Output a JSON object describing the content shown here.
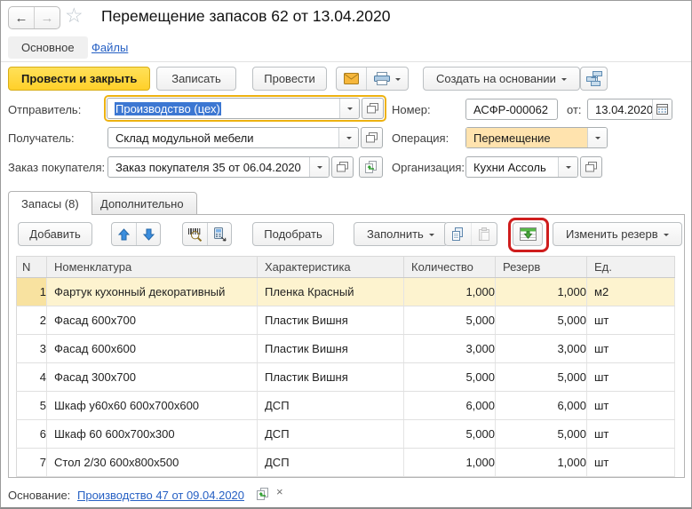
{
  "window": {
    "title": "Перемещение запасов 62 от 13.04.2020"
  },
  "nav": {
    "main_tab": "Основное",
    "files_link": "Файлы"
  },
  "toolbar": {
    "post_and_close": "Провести и закрыть",
    "write": "Записать",
    "post": "Провести",
    "create_based_on": "Создать на основании"
  },
  "form": {
    "sender": {
      "label": "Отправитель:",
      "value": "Производство (цех)"
    },
    "receiver": {
      "label": "Получатель:",
      "value": "Склад модульной мебели"
    },
    "customer_order": {
      "label": "Заказ покупателя:",
      "value": "Заказ покупателя 35 от 06.04.2020"
    },
    "number": {
      "label": "Номер:",
      "value": "АСФР-000062"
    },
    "date": {
      "label": "от:",
      "value": "13.04.2020"
    },
    "operation": {
      "label": "Операция:",
      "value": "Перемещение"
    },
    "organization": {
      "label": "Организация:",
      "value": "Кухни Ассоль"
    }
  },
  "tabs": {
    "inventory": "Запасы (8)",
    "additional": "Дополнительно"
  },
  "table_toolbar": {
    "add": "Добавить",
    "pick": "Подобрать",
    "fill": "Заполнить",
    "change_reserve": "Изменить резерв"
  },
  "table": {
    "columns": [
      "N",
      "Номенклатура",
      "Характеристика",
      "Количество",
      "Резерв",
      "Ед."
    ],
    "rows": [
      {
        "n": "1",
        "name": "Фартук кухонный декоративный",
        "characteristic": "Пленка Красный",
        "quantity": "1,000",
        "reserve": "1,000",
        "unit": "м2",
        "selected": true
      },
      {
        "n": "2",
        "name": "Фасад 600х700",
        "characteristic": "Пластик Вишня",
        "quantity": "5,000",
        "reserve": "5,000",
        "unit": "шт",
        "selected": false
      },
      {
        "n": "3",
        "name": "Фасад 600х600",
        "characteristic": "Пластик Вишня",
        "quantity": "3,000",
        "reserve": "3,000",
        "unit": "шт",
        "selected": false
      },
      {
        "n": "4",
        "name": "Фасад 300х700",
        "characteristic": "Пластик Вишня",
        "quantity": "5,000",
        "reserve": "5,000",
        "unit": "шт",
        "selected": false
      },
      {
        "n": "5",
        "name": "Шкаф у60х60 600х700х600",
        "characteristic": "ДСП",
        "quantity": "6,000",
        "reserve": "6,000",
        "unit": "шт",
        "selected": false
      },
      {
        "n": "6",
        "name": "Шкаф 60 600х700х300",
        "characteristic": "ДСП",
        "quantity": "5,000",
        "reserve": "5,000",
        "unit": "шт",
        "selected": false
      },
      {
        "n": "7",
        "name": "Стол 2/30 600х800х500",
        "characteristic": "ДСП",
        "quantity": "1,000",
        "reserve": "1,000",
        "unit": "шт",
        "selected": false
      }
    ]
  },
  "footer": {
    "label": "Основание:",
    "base_link": "Производство 47 от 09.04.2020",
    "clear": "×"
  },
  "icons": {
    "back": "←",
    "forward": "→",
    "favorite": "☆",
    "mail": "envelope-icon",
    "print": "printer-icon",
    "structure": "subordination-structure-icon",
    "open": "open-in-new-icon",
    "calendar": "calendar-icon",
    "open_document": "open-document-green-icon",
    "move_up": "arrow-up-icon",
    "move_down": "arrow-down-icon",
    "barcode": "barcode-scan-icon",
    "terminal": "data-terminal-icon",
    "copy": "copy-icon",
    "paste": "paste-icon",
    "reserve_table": "reserve-table-icon"
  },
  "colors": {
    "accent_button": "#ffd02a",
    "focus_ring": "#edb211",
    "selection": "#3c77d2",
    "operation_field_bg": "#ffe3ae",
    "selected_row_bg": "#fdf3cf",
    "selected_row_number_bg": "#f8e2a0",
    "link": "#2660c4",
    "annotation_red": "#cf1d1d"
  }
}
